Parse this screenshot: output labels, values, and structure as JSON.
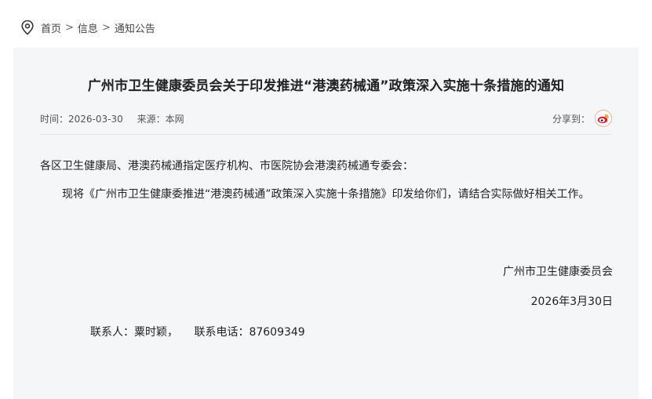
{
  "breadcrumb": {
    "items": [
      "首页",
      "信息",
      "通知公告"
    ],
    "separator": ">"
  },
  "article": {
    "title": "广州市卫生健康委员会关于印发推进“港澳药械通”政策深入实施十条措施的通知",
    "time_label": "时间：",
    "time_value": "2026-03-30",
    "source_label": "来源：",
    "source_value": "本网",
    "share_label": "分享到：",
    "share_icon": "weibo-icon",
    "greeting": "各区卫生健康局、港澳药械通指定医疗机构、市医院协会港澳药械通专委会：",
    "paragraph": "现将《广州市卫生健康委推进“港澳药械通”政策深入实施十条措施》印发给你们，请结合实际做好相关工作。",
    "signature_org": "广州市卫生健康委员会",
    "signature_date": "2026年3月30日",
    "contact_person": "联系人：粟时颖，",
    "contact_phone": "联系电话：87609349"
  },
  "colors": {
    "panel_bg": "#f5f6f8",
    "weibo_red": "#e6162d",
    "weibo_orange": "#f29100"
  }
}
